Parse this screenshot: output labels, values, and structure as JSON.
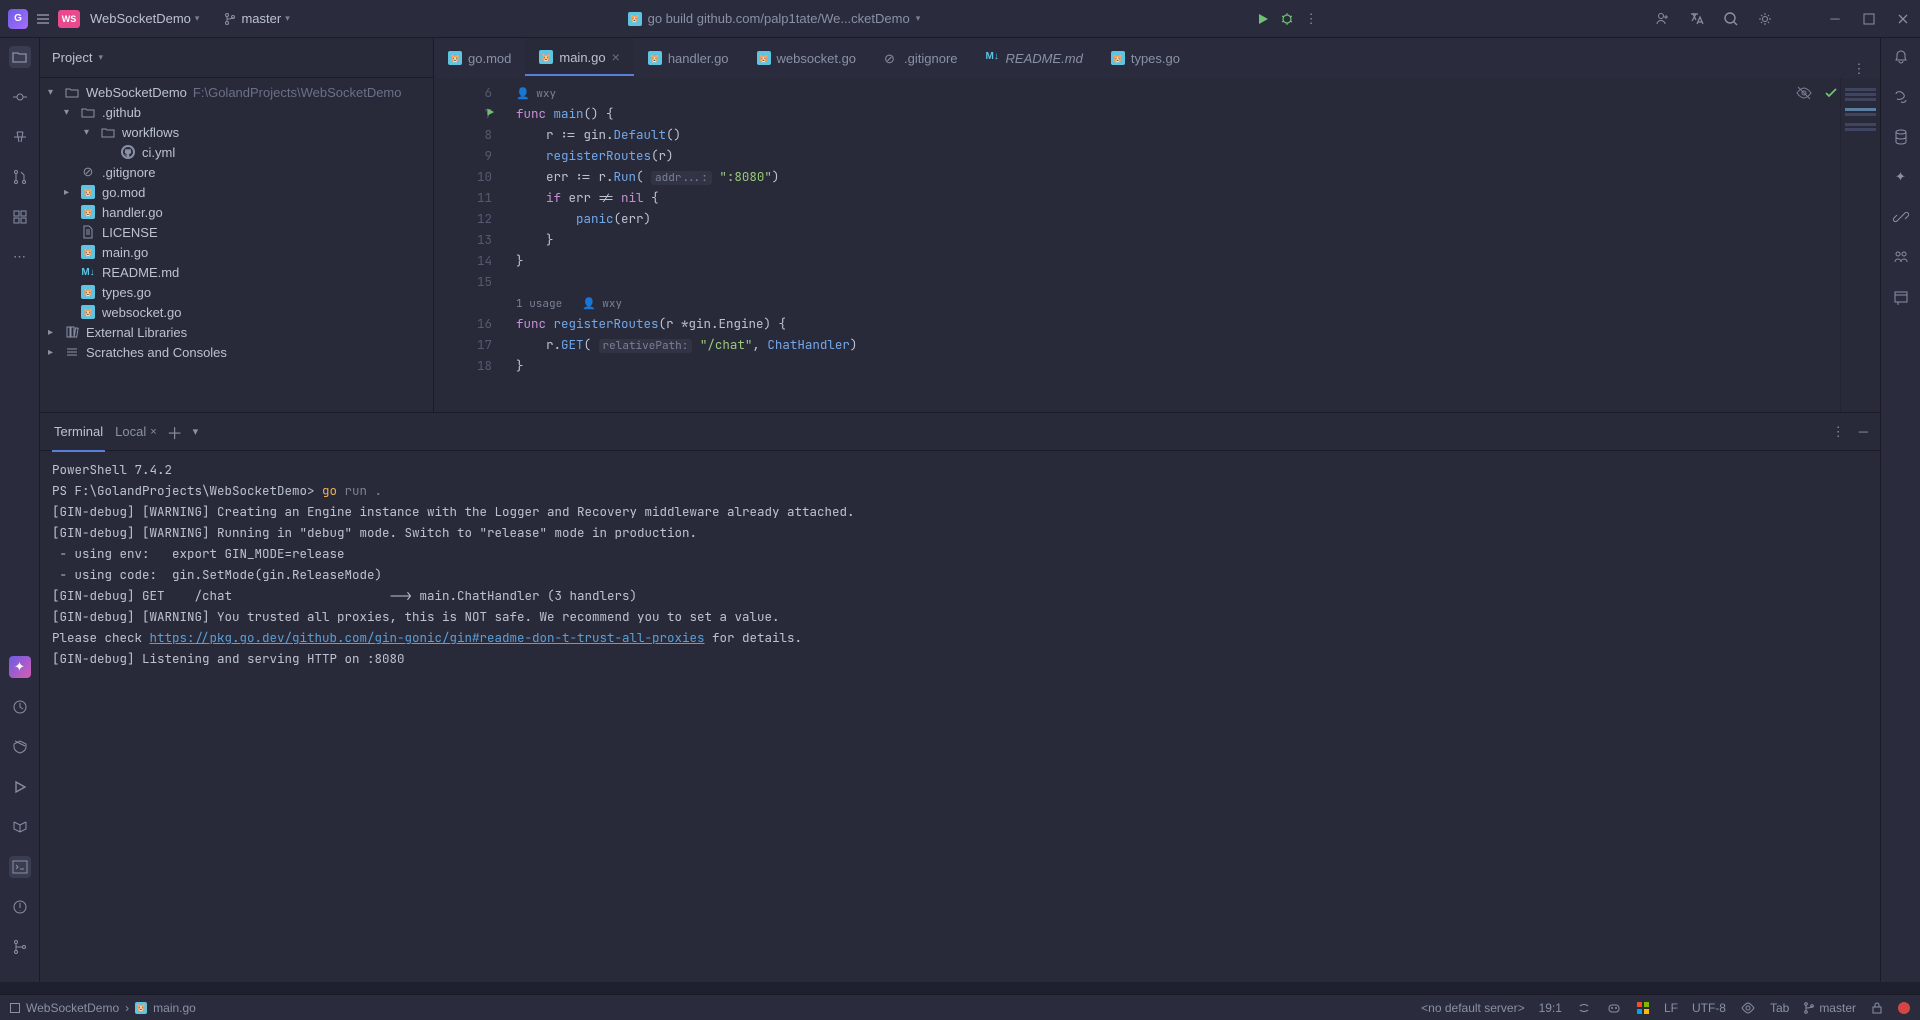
{
  "titlebar": {
    "project": "WebSocketDemo",
    "branch": "master",
    "build_cmd": "go build github.com/palp1tate/We...cketDemo"
  },
  "left_tools": [
    "folder",
    "commit",
    "structure",
    "pull-requests",
    "more"
  ],
  "right_tools": [
    "notifications",
    "bookmarks",
    "database",
    "ai",
    "links",
    "collab",
    "preview"
  ],
  "project_panel": {
    "title": "Project",
    "tree": [
      {
        "l": 0,
        "arrow": "v",
        "icon": "folder",
        "label": "WebSocketDemo",
        "path": "F:\\GolandProjects\\WebSocketDemo"
      },
      {
        "l": 1,
        "arrow": "v",
        "icon": "folder",
        "label": ".github"
      },
      {
        "l": 2,
        "arrow": "v",
        "icon": "folder",
        "label": "workflows"
      },
      {
        "l": 3,
        "arrow": "",
        "icon": "github",
        "label": "ci.yml"
      },
      {
        "l": 1,
        "arrow": "",
        "icon": "gitignore",
        "label": ".gitignore"
      },
      {
        "l": 1,
        "arrow": ">",
        "icon": "go",
        "label": "go.mod"
      },
      {
        "l": 1,
        "arrow": "",
        "icon": "go",
        "label": "handler.go"
      },
      {
        "l": 1,
        "arrow": "",
        "icon": "file",
        "label": "LICENSE"
      },
      {
        "l": 1,
        "arrow": "",
        "icon": "go",
        "label": "main.go"
      },
      {
        "l": 1,
        "arrow": "",
        "icon": "md",
        "label": "README.md"
      },
      {
        "l": 1,
        "arrow": "",
        "icon": "go",
        "label": "types.go"
      },
      {
        "l": 1,
        "arrow": "",
        "icon": "go",
        "label": "websocket.go"
      },
      {
        "l": 0,
        "arrow": ">",
        "icon": "lib",
        "label": "External Libraries"
      },
      {
        "l": 0,
        "arrow": ">",
        "icon": "scratch",
        "label": "Scratches and Consoles"
      }
    ]
  },
  "tabs": [
    {
      "icon": "go",
      "label": "go.mod",
      "active": false
    },
    {
      "icon": "go",
      "label": "main.go",
      "active": true,
      "close": true
    },
    {
      "icon": "go",
      "label": "handler.go",
      "active": false
    },
    {
      "icon": "go",
      "label": "websocket.go",
      "active": false
    },
    {
      "icon": "gitignore",
      "label": ".gitignore",
      "active": false
    },
    {
      "icon": "md",
      "label": "README.md",
      "active": false,
      "italic": true
    },
    {
      "icon": "go",
      "label": "types.go",
      "active": false
    }
  ],
  "editor": {
    "author_top": "wxy",
    "lines": [
      {
        "n": 6,
        "html": ""
      },
      {
        "n": 7,
        "run": true,
        "html": "<span class='kw'>func</span> <span class='fn'>main</span>() {"
      },
      {
        "n": 8,
        "html": "    r := gin.<span class='fn'>Default</span>()"
      },
      {
        "n": 9,
        "html": "    <span class='fn'>registerRoutes</span>(r)"
      },
      {
        "n": 10,
        "html": "    err := r.<span class='fn'>Run</span>( <span class='hint'>addr...:</span> <span class='str'>\":8080\"</span>)"
      },
      {
        "n": 11,
        "html": "    <span class='kw'>if</span> err != <span class='kw'>nil</span> {"
      },
      {
        "n": 12,
        "html": "        <span class='fn'>panic</span>(err)"
      },
      {
        "n": 13,
        "html": "    }"
      },
      {
        "n": 14,
        "html": "}"
      },
      {
        "n": 15,
        "html": ""
      },
      {
        "usage": "1 usage",
        "author": "wxy"
      },
      {
        "n": 16,
        "html": "<span class='kw'>func</span> <span class='fn'>registerRoutes</span>(r *gin.Engine) {"
      },
      {
        "n": 17,
        "html": "    r.<span class='fn'>GET</span>( <span class='hint'>relativePath:</span> <span class='str'>\"/chat\"</span>, <span class='fn'>ChatHandler</span>)"
      },
      {
        "n": 18,
        "html": "}"
      }
    ]
  },
  "terminal": {
    "title": "Terminal",
    "sub": "Local",
    "lines": [
      "PowerShell 7.4.2",
      "PS F:\\GolandProjects\\WebSocketDemo> <span class='term-cmd'>go</span> <span class='term-arg'>run .</span>",
      "[GIN-debug] [WARNING] Creating an Engine instance with the Logger and Recovery middleware already attached.",
      "",
      "[GIN-debug] [WARNING] Running in \"debug\" mode. Switch to \"release\" mode in production.",
      " - using env:   export GIN_MODE=release",
      " - using code:  gin.SetMode(gin.ReleaseMode)",
      "",
      "[GIN-debug] GET    /chat                     --> main.ChatHandler (3 handlers)",
      "[GIN-debug] [WARNING] You trusted all proxies, this is NOT safe. We recommend you to set a value.",
      "Please check <span class='term-link'>https://pkg.go.dev/github.com/gin-gonic/gin#readme-don-t-trust-all-proxies</span> for details.",
      "[GIN-debug] Listening and serving HTTP on :8080"
    ]
  },
  "statusbar": {
    "breadcrumb1": "WebSocketDemo",
    "breadcrumb2": "main.go",
    "server": "<no default server>",
    "pos": "19:1",
    "le": "LF",
    "enc": "UTF-8",
    "indent": "Tab",
    "branch": "master"
  }
}
